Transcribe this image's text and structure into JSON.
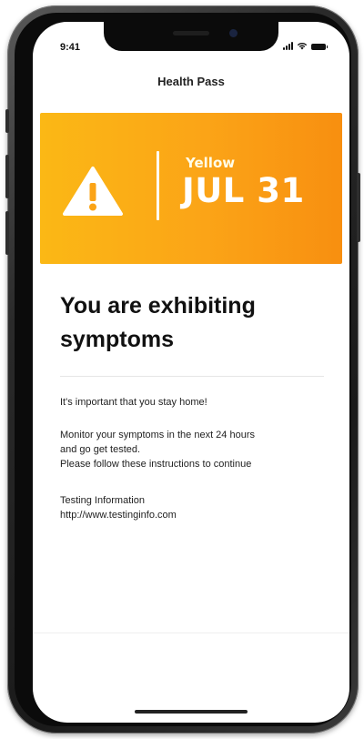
{
  "status_bar": {
    "time": "9:41",
    "icons": [
      "signal-icon",
      "wifi-icon",
      "battery-icon"
    ]
  },
  "header": {
    "title": "Health Pass"
  },
  "banner": {
    "icon": "warning-icon",
    "status_label": "Yellow",
    "date": "JUL 31",
    "colors": {
      "start": "#fbb815",
      "end": "#f88f10"
    }
  },
  "message": {
    "headline": "You are exhibiting symptoms",
    "paragraph1": "It's important that you stay home!",
    "paragraph2_lines": [
      "Monitor your symptoms in the next 24 hours",
      "and go get tested.",
      "Please follow these instructions to continue"
    ],
    "testing_label": "Testing Information",
    "testing_link": "http://www.testinginfo.com"
  }
}
